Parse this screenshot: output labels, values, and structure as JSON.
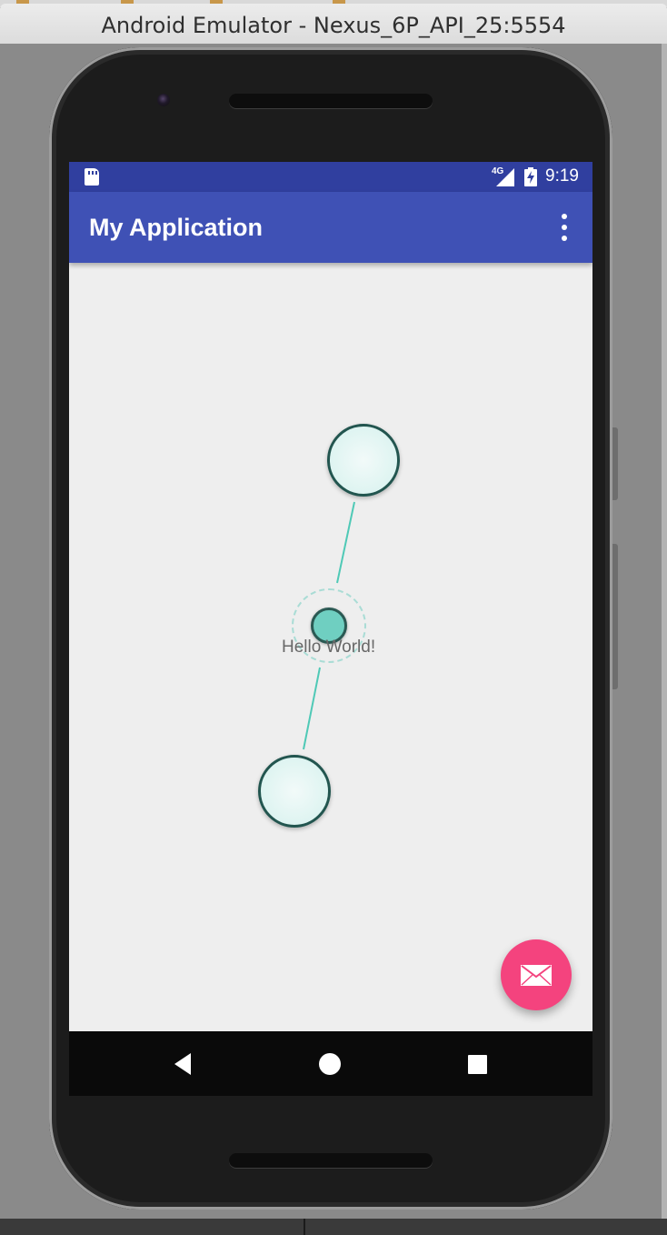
{
  "window": {
    "title": "Android Emulator - Nexus_6P_API_25:5554"
  },
  "status_bar": {
    "network": "4G",
    "time": "9:19",
    "icons": [
      "sd-card-icon",
      "signal-icon",
      "battery-charging-icon"
    ]
  },
  "app_bar": {
    "title": "My Application",
    "overflow_icon": "more-vert-icon"
  },
  "content": {
    "label": "Hello World!"
  },
  "fab": {
    "icon": "mail-icon"
  },
  "nav_bar": {
    "buttons": [
      "back-icon",
      "home-icon",
      "recents-icon"
    ]
  },
  "colors": {
    "status_bar": "#303f9f",
    "app_bar": "#3f51b5",
    "fab": "#f4437e",
    "node_border": "#22554f",
    "node_accent": "#6fcfc1",
    "connector": "#4fc9b6",
    "content_bg": "#eeeeee"
  }
}
